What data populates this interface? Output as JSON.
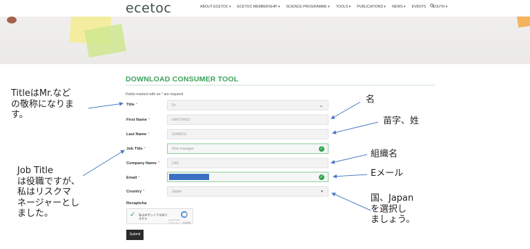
{
  "header": {
    "logo": "ecetoc",
    "nav": [
      {
        "label": "ABOUT ECETOC ▾"
      },
      {
        "label": "ECETOC MEMBERSHIP ▾"
      },
      {
        "label": "SCIENCE PROGRAMME ▾"
      },
      {
        "label": "TOOLS ▾"
      },
      {
        "label": "PUBLICATIONS ▾"
      },
      {
        "label": "NEWS ▾"
      },
      {
        "label": "EVENTS"
      },
      {
        "label": "YOUTH ▾"
      }
    ],
    "search_icon": "search-icon"
  },
  "page": {
    "title": "DOWNLOAD CONSUMER TOOL",
    "required_note": "Fields marked with an * are required"
  },
  "form": {
    "title_label": "Title",
    "title_value": "Dr",
    "first_name_label": "First Name",
    "first_name_value": "HIROYASU",
    "last_name_label": "Last Name",
    "last_name_value": "SHIMIZU",
    "job_title_label": "Job Title",
    "job_title_value": "Risk manager",
    "company_label": "Company Name",
    "company_value": "LAD",
    "email_label": "Email",
    "country_label": "Country",
    "country_value": "Japan",
    "recaptcha_label": "Recaptcha",
    "recaptcha_text": "私はロボットではありません",
    "recaptcha_brand": "reCAPTCHA",
    "recaptcha_sub": "プライバシー - 利用規約",
    "submit_label": "Submit",
    "required_mark": "*",
    "valid_color": "#2ea44f",
    "accent_color": "#3aa25a"
  },
  "annotations": {
    "title_note": [
      "Titleは",
      "Mr.など",
      "の敬称になりま",
      "す。"
    ],
    "title_note_lines": [
      "TitleはMr.など",
      "の敬称になりま",
      "す。"
    ],
    "first_name_note": "名",
    "last_name_note": "苗字、姓",
    "company_note": "組織名",
    "email_note": "Eメール",
    "country_note_lines": [
      "国、Japan",
      "を選択し",
      "ましょう。"
    ],
    "job_note_lines": [
      "Job Title",
      "は役職ですが、",
      "私はリスクマ",
      "ネージャーとし",
      "ました。"
    ]
  }
}
